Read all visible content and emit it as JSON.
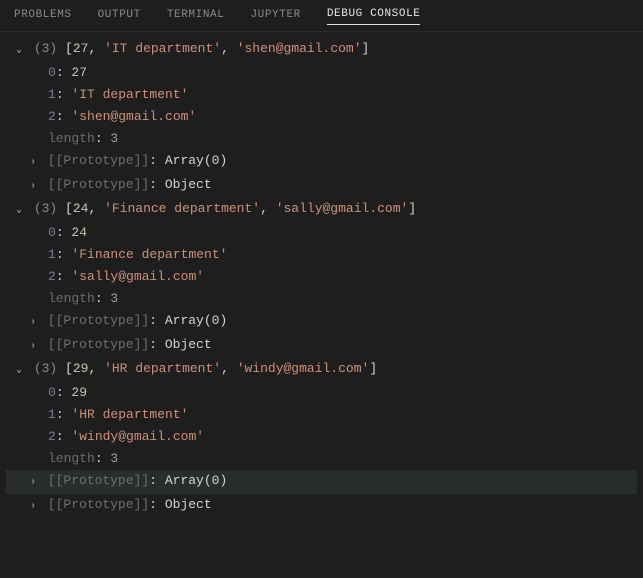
{
  "tabs": [
    {
      "label": "PROBLEMS",
      "active": false
    },
    {
      "label": "OUTPUT",
      "active": false
    },
    {
      "label": "TERMINAL",
      "active": false
    },
    {
      "label": "JUPYTER",
      "active": false
    },
    {
      "label": "DEBUG CONSOLE",
      "active": true
    }
  ],
  "protoLabel": "[[Prototype]]",
  "lengthLabel": "length",
  "arrayOf0": "Array(0)",
  "objectLbl": "Object",
  "entries": [
    {
      "count": "(3)",
      "summaryParts": [
        "27",
        "'IT department'",
        "'shen@gmail.com'"
      ],
      "rows": [
        {
          "key": "0",
          "value": "27",
          "type": "num"
        },
        {
          "key": "1",
          "value": "'IT department'",
          "type": "str"
        },
        {
          "key": "2",
          "value": "'shen@gmail.com'",
          "type": "str"
        }
      ],
      "length": "3",
      "highlightProto": false
    },
    {
      "count": "(3)",
      "summaryParts": [
        "24",
        "'Finance department'",
        "'sally@gmail.com'"
      ],
      "rows": [
        {
          "key": "0",
          "value": "24",
          "type": "num"
        },
        {
          "key": "1",
          "value": "'Finance department'",
          "type": "str"
        },
        {
          "key": "2",
          "value": "'sally@gmail.com'",
          "type": "str"
        }
      ],
      "length": "3",
      "highlightProto": false
    },
    {
      "count": "(3)",
      "summaryParts": [
        "29",
        "'HR department'",
        "'windy@gmail.com'"
      ],
      "rows": [
        {
          "key": "0",
          "value": "29",
          "type": "num"
        },
        {
          "key": "1",
          "value": "'HR department'",
          "type": "str"
        },
        {
          "key": "2",
          "value": "'windy@gmail.com'",
          "type": "str"
        }
      ],
      "length": "3",
      "highlightProto": true
    }
  ]
}
